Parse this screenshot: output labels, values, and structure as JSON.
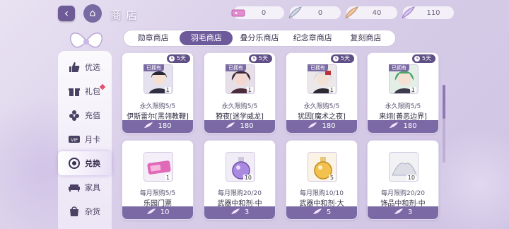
{
  "header": {
    "title": "商店",
    "back_icon": "back-arrow-icon",
    "home_icon": "home-icon"
  },
  "currencies": [
    {
      "icon": "ticket-icon",
      "value": "0"
    },
    {
      "icon": "silver-feather-icon",
      "value": "0"
    },
    {
      "icon": "gold-feather-icon",
      "value": "40"
    },
    {
      "icon": "rainbow-feather-icon",
      "value": "110"
    }
  ],
  "tabs": [
    "勋章商店",
    "羽毛商店",
    "叠分乐商店",
    "纪念章商店",
    "复刻商店"
  ],
  "active_tab": "羽毛商店",
  "sidebar": {
    "items": [
      {
        "label": "优选",
        "icon": "thumbs-up-icon"
      },
      {
        "label": "礼包",
        "icon": "gift-icon"
      },
      {
        "label": "充值",
        "icon": "flower-icon"
      },
      {
        "label": "月卡",
        "icon": "vip-card-icon"
      },
      {
        "label": "兑换",
        "icon": "exchange-icon"
      },
      {
        "label": "家具",
        "icon": "sofa-icon"
      },
      {
        "label": "杂货",
        "icon": "bag-icon"
      }
    ],
    "active": "兑换"
  },
  "cards": [
    {
      "days": "5天",
      "owned": "已拥有",
      "qty": "1",
      "limit": "永久限购5/5",
      "name": "伊斯雷尔[黑翎教鞭]",
      "price": "180",
      "thumb": "portrait-dark-hair"
    },
    {
      "days": "5天",
      "owned": "已拥有",
      "qty": "1",
      "limit": "永久限购5/5",
      "name": "獠夜[迷学威龙]",
      "price": "180",
      "thumb": "portrait-dark-red"
    },
    {
      "days": "5天",
      "owned": "已拥有",
      "qty": "1",
      "limit": "永久限购5/5",
      "name": "犹因[魔术之夜]",
      "price": "180",
      "thumb": "portrait-white-hair"
    },
    {
      "days": "5天",
      "owned": "已拥有",
      "qty": "1",
      "limit": "永久限购5/5",
      "name": "来翊[善恶边界]",
      "price": "180",
      "thumb": "portrait-green-hair"
    },
    {
      "qty": "1",
      "limit": "每月限购5/5",
      "name": "乐园门票",
      "price": "10",
      "thumb": "pink-ticket"
    },
    {
      "qty": "10",
      "limit": "每月限购20/20",
      "name": "武器中和剂·中",
      "price": "3",
      "thumb": "purple-potion"
    },
    {
      "qty": "5",
      "limit": "每月限购10/10",
      "name": "武器中和剂·大",
      "price": "5",
      "thumb": "gold-potion"
    },
    {
      "qty": "10",
      "limit": "每月限购20/20",
      "name": "饰品中和剂·中",
      "price": "3",
      "thumb": "white-powder"
    }
  ],
  "colors": {
    "accent": "#6d5a9a",
    "price_bar": "#7b69a6",
    "badge": "#5f4f86",
    "notice": "#e2506b"
  }
}
